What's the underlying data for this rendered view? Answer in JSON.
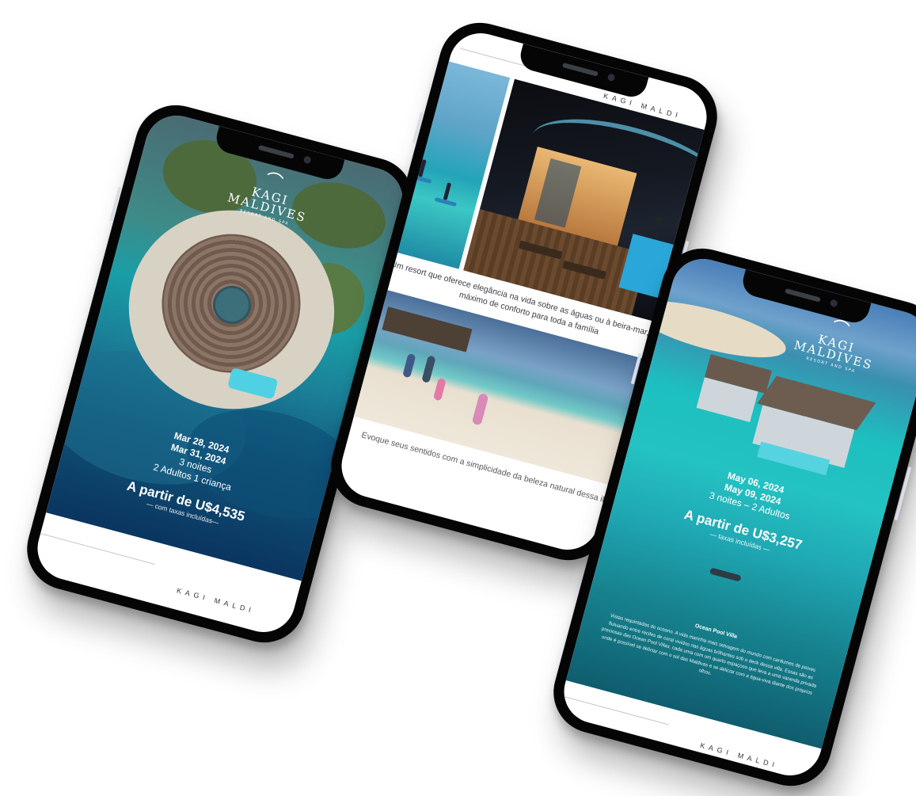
{
  "brand": {
    "name_line1": "KAGI",
    "name_line2": "MALDIVES",
    "subtitle": "RESORT AND SPA",
    "footer_text": "KAGI MALDI"
  },
  "phone1": {
    "checkin": "Mar 28, 2024",
    "checkout": "Mar 31, 2024",
    "nights": "3 noites",
    "guests": "2 Adultos 1 criança",
    "price": "A partir de U$4,535",
    "tax_note": "— com taxas incluídas—"
  },
  "phone2": {
    "caption1": "Um resort que oferece elegância na vida sobre as águas ou à beira-mar, com o máximo de conforto para toda a família",
    "caption2": "Evoque seus sentidos com a simplicidade da beleza natural dessa ilha"
  },
  "phone3": {
    "checkin": "May 06, 2024",
    "checkout": "May 09, 2024",
    "nights_guests": "3 noites – 2 Adultos",
    "price": "A partir de U$3,257",
    "tax_note": "— taxas incluídas —",
    "villa_title": "Ocean Pool Villa",
    "villa_desc": "Vistas requintadas do oceano. A vida marinha mais selvagem do mundo com cardumes de peixes flutuando entre recifes de coral vividos nas águas brilhantes sob o deck dessa villa. Essas são as preciosas das Ocean Pool Villas, cada uma com um quarto espaçoso que leva a uma varanda privada onde é possível se deliciar com o sol das Maldivas e se deliciar com a água-viva diante dos próprios olhos."
  }
}
